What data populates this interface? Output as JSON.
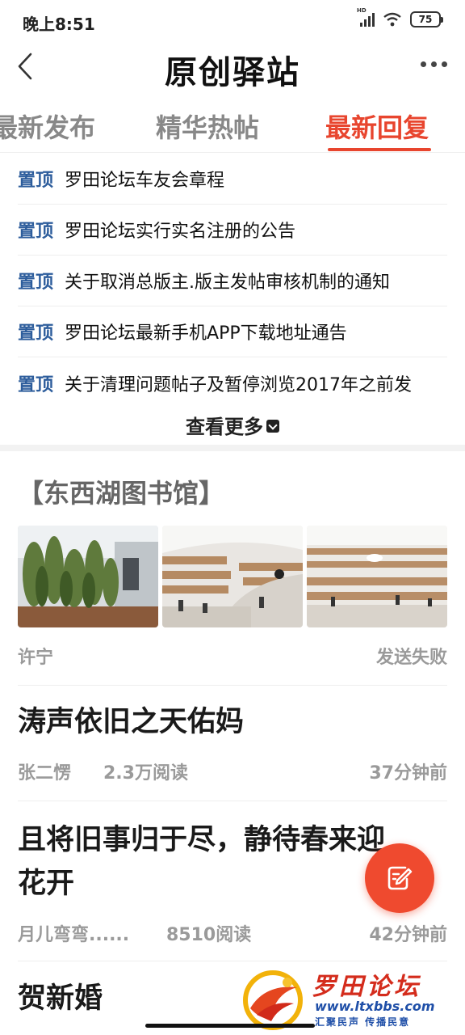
{
  "status_bar": {
    "time": "晚上8:51",
    "network_label": "HD",
    "battery": "75"
  },
  "header": {
    "title": "原创驿站"
  },
  "tabs": [
    {
      "label": "最新发布",
      "active": false
    },
    {
      "label": "精华热帖",
      "active": false
    },
    {
      "label": "最新回复",
      "active": true
    }
  ],
  "pinned": {
    "tag": "置顶",
    "items": [
      "罗田论坛车友会章程",
      "罗田论坛实行实名注册的公告",
      "关于取消总版主.版主发帖审核机制的通知",
      "罗田论坛最新手机APP下载地址通告",
      "关于清理问题帖子及暂停浏览2017年之前发"
    ],
    "see_more": "查看更多"
  },
  "feed": [
    {
      "title": "【东西湖图书馆】",
      "author": "许宁",
      "status": "发送失败",
      "image_count": 3
    },
    {
      "title": "涛声依旧之天佑妈",
      "author": "张二愣",
      "reads": "2.3万阅读",
      "time": "37分钟前"
    },
    {
      "title": "且将旧事归于尽，静待春来迎花开",
      "author": "月儿弯弯......",
      "reads": "8510阅读",
      "time": "42分钟前"
    },
    {
      "title": "贺新婚"
    }
  ],
  "watermark": {
    "name": "罗田论坛",
    "url": "www.ltxbbs.com",
    "slogan": "汇聚民声  传播民意"
  },
  "colors": {
    "accent": "#e8452e",
    "pin_tag": "#2d5d9c",
    "meta_gray": "#9a9a9a"
  }
}
